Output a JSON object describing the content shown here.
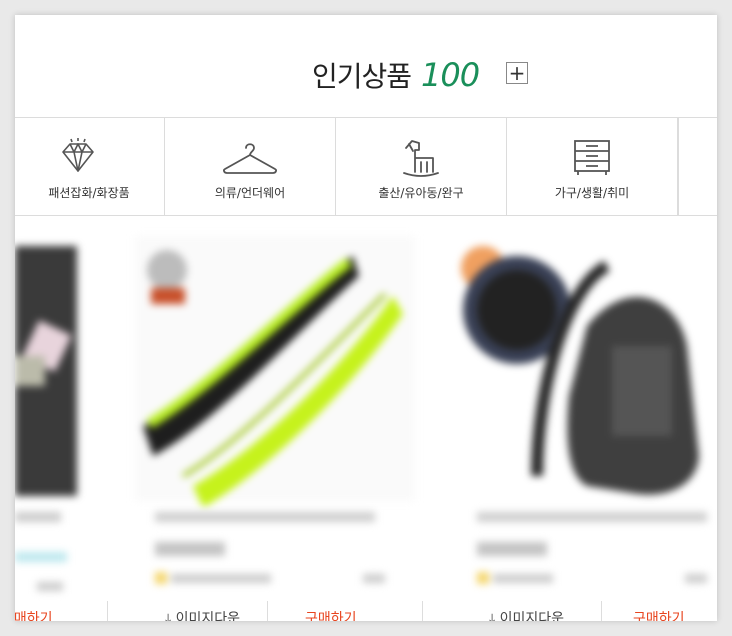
{
  "header": {
    "title": "인기상품",
    "title_number": "100",
    "expand_button": "+"
  },
  "categories": [
    {
      "label": "패션잡화/화장품",
      "icon": "diamond-icon"
    },
    {
      "label": "의류/언더웨어",
      "icon": "hanger-icon"
    },
    {
      "label": "출산/유아동/완구",
      "icon": "rocking-horse-icon"
    },
    {
      "label": "가구/생활/취미",
      "icon": "drawer-cabinet-icon"
    }
  ],
  "cards": [
    {
      "download_label": "이미지다운",
      "buy_label": "구매하기"
    },
    {
      "download_label": "이미지다운",
      "buy_label": "구매하기"
    }
  ],
  "colors": {
    "accent_green": "#1a8f5a",
    "buy_orange": "#e8451f",
    "bag_lime": "#c6f21c",
    "border": "#dcdcdc"
  }
}
